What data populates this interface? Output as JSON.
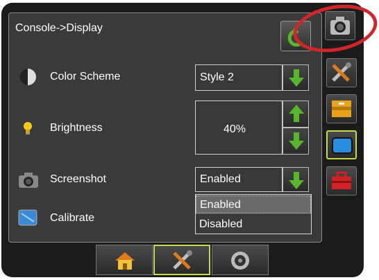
{
  "header": {
    "breadcrumb": "Console->Display",
    "back_icon": "back-arrow-icon"
  },
  "settings": {
    "color_scheme": {
      "label": "Color Scheme",
      "value": "Style 2",
      "icon": "color-scheme-icon"
    },
    "brightness": {
      "label": "Brightness",
      "value": "40%",
      "icon": "lightbulb-icon"
    },
    "screenshot": {
      "label": "Screenshot",
      "value": "Enabled",
      "icon": "camera-icon"
    },
    "calibrate": {
      "label": "Calibrate",
      "icon": "calibrate-icon"
    }
  },
  "screenshot_dropdown": {
    "options": [
      "Enabled",
      "Disabled"
    ],
    "selected": "Enabled"
  },
  "side_tabs": [
    {
      "name": "camera",
      "icon": "camera-icon"
    },
    {
      "name": "tools",
      "icon": "tools-icon"
    },
    {
      "name": "storage",
      "icon": "drawer-icon"
    },
    {
      "name": "display",
      "icon": "display-icon",
      "active": true
    },
    {
      "name": "toolbox",
      "icon": "toolbox-icon"
    }
  ],
  "bottom_tabs": [
    {
      "name": "home",
      "icon": "home-icon"
    },
    {
      "name": "tools",
      "icon": "tools-icon",
      "active": true
    },
    {
      "name": "gps",
      "icon": "satellite-icon"
    }
  ],
  "colors": {
    "accent_green": "#58b52d",
    "active_border": "#c6dc4a",
    "highlight_circle": "#d0262b"
  }
}
